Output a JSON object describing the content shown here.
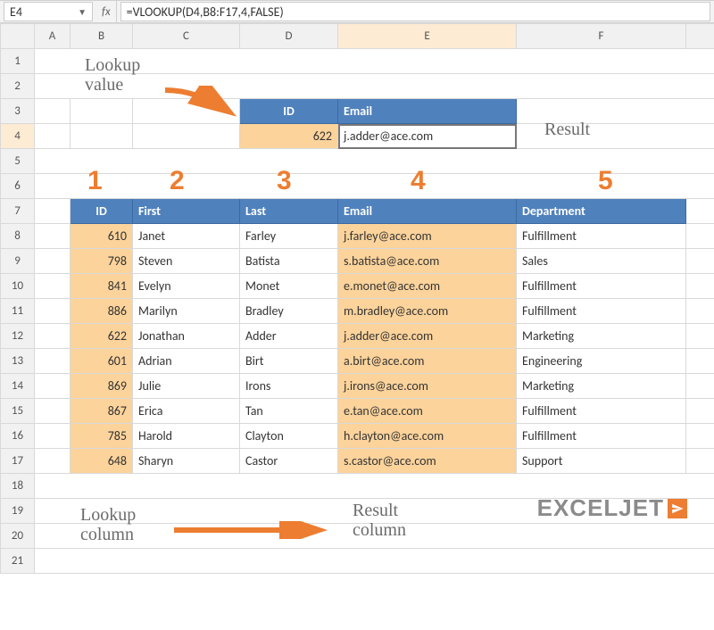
{
  "formula_bar": {
    "name_box": "E4",
    "fx_label": "fx",
    "formula": "=VLOOKUP(D4,B8:F17,4,FALSE)"
  },
  "columns": [
    "A",
    "B",
    "C",
    "D",
    "E",
    "F"
  ],
  "row_numbers": [
    1,
    2,
    3,
    4,
    5,
    6,
    7,
    8,
    9,
    10,
    11,
    12,
    13,
    14,
    15,
    16,
    17,
    18,
    19,
    20,
    21
  ],
  "lookup_box": {
    "headers": {
      "id": "ID",
      "email": "Email"
    },
    "values": {
      "id": "622",
      "email": "j.adder@ace.com"
    }
  },
  "data_table": {
    "headers": {
      "id": "ID",
      "first": "First",
      "last": "Last",
      "email": "Email",
      "dept": "Department"
    },
    "rows": [
      {
        "id": "610",
        "first": "Janet",
        "last": "Farley",
        "email": "j.farley@ace.com",
        "dept": "Fulfillment"
      },
      {
        "id": "798",
        "first": "Steven",
        "last": "Batista",
        "email": "s.batista@ace.com",
        "dept": "Sales"
      },
      {
        "id": "841",
        "first": "Evelyn",
        "last": "Monet",
        "email": "e.monet@ace.com",
        "dept": "Fulfillment"
      },
      {
        "id": "886",
        "first": "Marilyn",
        "last": "Bradley",
        "email": "m.bradley@ace.com",
        "dept": "Fulfillment"
      },
      {
        "id": "622",
        "first": "Jonathan",
        "last": "Adder",
        "email": "j.adder@ace.com",
        "dept": "Marketing"
      },
      {
        "id": "601",
        "first": "Adrian",
        "last": "Birt",
        "email": "a.birt@ace.com",
        "dept": "Engineering"
      },
      {
        "id": "869",
        "first": "Julie",
        "last": "Irons",
        "email": "j.irons@ace.com",
        "dept": "Marketing"
      },
      {
        "id": "867",
        "first": "Erica",
        "last": "Tan",
        "email": "e.tan@ace.com",
        "dept": "Fulfillment"
      },
      {
        "id": "785",
        "first": "Harold",
        "last": "Clayton",
        "email": "h.clayton@ace.com",
        "dept": "Fulfillment"
      },
      {
        "id": "648",
        "first": "Sharyn",
        "last": "Castor",
        "email": "s.castor@ace.com",
        "dept": "Support"
      }
    ]
  },
  "annotations": {
    "lookup_value": "Lookup\nvalue",
    "result": "Result",
    "col_numbers": [
      "1",
      "2",
      "3",
      "4",
      "5"
    ],
    "lookup_column": "Lookup\ncolumn",
    "result_column": "Result\ncolumn"
  },
  "logo": {
    "text": "EXCELJET"
  }
}
